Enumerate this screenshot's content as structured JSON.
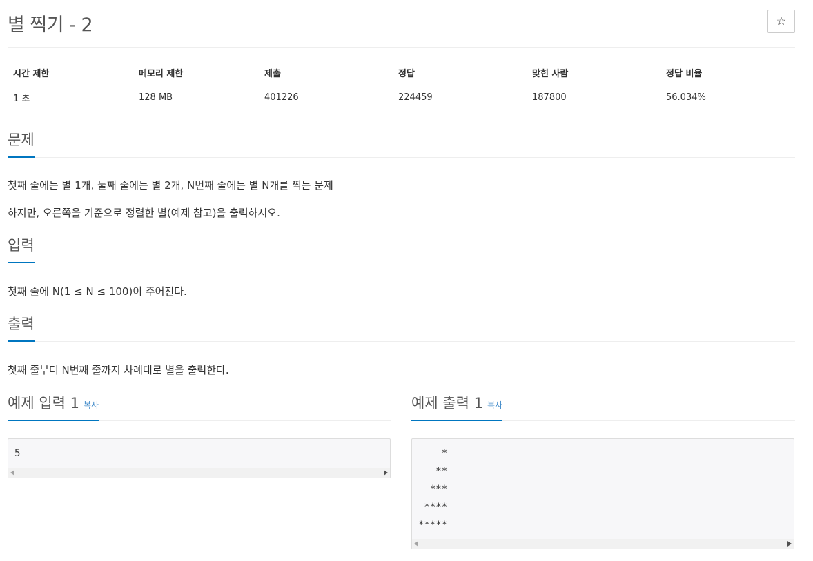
{
  "problem": {
    "title": "별 찍기 - 2",
    "star_icon": "☆"
  },
  "info_table": {
    "headers": [
      "시간 제한",
      "메모리 제한",
      "제출",
      "정답",
      "맞힌 사람",
      "정답 비율"
    ],
    "values": [
      "1 초",
      "128 MB",
      "401226",
      "224459",
      "187800",
      "56.034%"
    ]
  },
  "sections": {
    "description": {
      "title": "문제",
      "lines": [
        "첫째 줄에는 별 1개, 둘째 줄에는 별 2개, N번째 줄에는 별 N개를 찍는 문제",
        "하지만, 오른쪽을 기준으로 정렬한 별(예제 참고)을 출력하시오."
      ]
    },
    "input": {
      "title": "입력",
      "text": "첫째 줄에 N(1 ≤ N ≤ 100)이 주어진다."
    },
    "output": {
      "title": "출력",
      "text": "첫째 줄부터 N번째 줄까지 차례대로 별을 출력한다."
    }
  },
  "samples": {
    "input": {
      "title": "예제 입력 1",
      "copy_label": "복사",
      "content": "5"
    },
    "output": {
      "title": "예제 출력 1",
      "copy_label": "복사",
      "content": "    *\n   **\n  ***\n ****\n*****"
    }
  },
  "colors": {
    "accent": "#0076c0",
    "link": "#428bca"
  }
}
